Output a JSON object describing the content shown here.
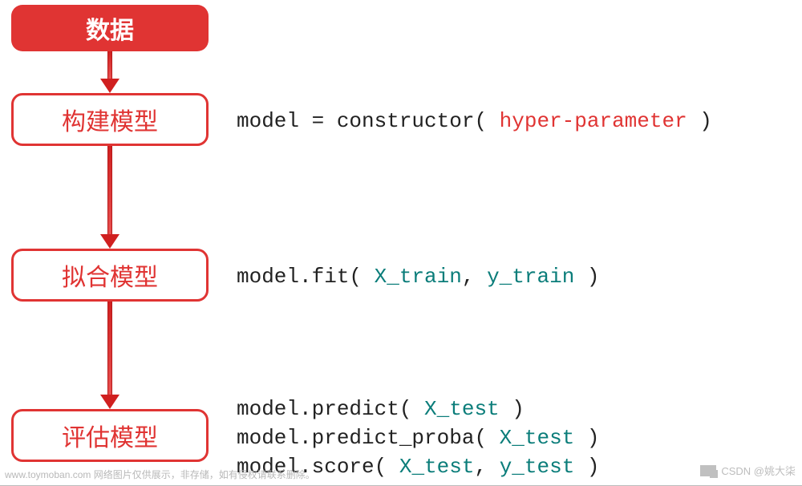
{
  "flow": {
    "start": "数据",
    "step1": "构建模型",
    "step2": "拟合模型",
    "step3": "评估模型"
  },
  "code": {
    "c1_a": "model = constructor( ",
    "c1_b": "hyper-parameter",
    "c1_c": " )",
    "c2_a": "model.fit( ",
    "c2_b": "X_train",
    "c2_c": ", ",
    "c2_d": "y_train",
    "c2_e": " )",
    "c3_l1a": "model.predict( ",
    "c3_l1b": "X_test",
    "c3_l1c": " )",
    "c3_l2a": "model.predict_proba( ",
    "c3_l2b": "X_test",
    "c3_l2c": " )",
    "c3_l3a": "model.score( ",
    "c3_l3b": "X_test",
    "c3_l3c": ", ",
    "c3_l3d": "y_test",
    "c3_l3e": " )"
  },
  "watermark": {
    "left": "www.toymoban.com 网络图片仅供展示，非存储，如有侵权请联系删除。",
    "right": "CSDN @姚大柒"
  }
}
